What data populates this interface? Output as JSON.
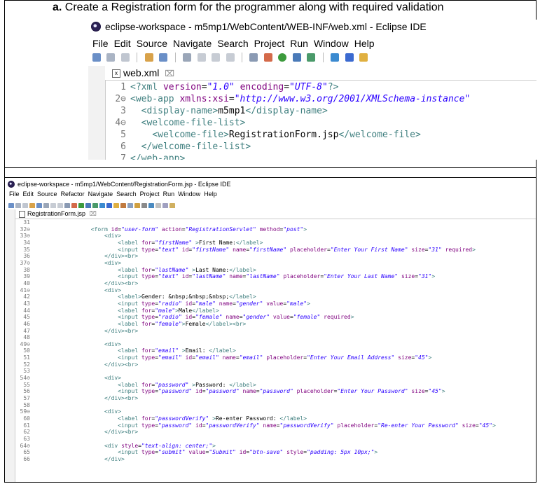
{
  "caption": {
    "prefix": "a.",
    "text": " Create a Registration form for the programmer along with required validation"
  },
  "top_window": {
    "title": "eclipse-workspace - m5mp1/WebContent/WEB-INF/web.xml - Eclipse IDE",
    "menu": [
      "File",
      "Edit",
      "Source",
      "Navigate",
      "Search",
      "Project",
      "Run",
      "Window",
      "Help"
    ],
    "tab_label": "web.xml",
    "tab_close": "⌧",
    "lines": [
      {
        "n": "1",
        "html": "<span class=\"tag\">&lt;?xml </span><span class=\"attr\">version</span><span class=\"plain\">=</span><span class=\"val\">\"1.0\"</span><span class=\"plain\"> </span><span class=\"attr\">encoding</span><span class=\"plain\">=</span><span class=\"val\">\"UTF-8\"</span><span class=\"tag\">?&gt;</span>"
      },
      {
        "n": "2⊖",
        "html": "<span class=\"tag\">&lt;web-app </span><span class=\"attr\">xmlns:xsi</span><span class=\"plain\">=</span><span class=\"val\">\"http://www.w3.org/2001/XMLSchema-instance\"</span>"
      },
      {
        "n": "3",
        "html": "  <span class=\"tag\">&lt;display-name&gt;</span><span class=\"plain\">m5mp1</span><span class=\"tag\">&lt;/display-name&gt;</span>"
      },
      {
        "n": "4⊖",
        "html": "  <span class=\"tag\">&lt;welcome-file-list&gt;</span>"
      },
      {
        "n": "5",
        "html": "    <span class=\"tag\">&lt;welcome-file&gt;</span><span class=\"plain\">RegistrationForm.jsp</span><span class=\"tag\">&lt;/welcome-file&gt;</span>"
      },
      {
        "n": "6",
        "html": "  <span class=\"tag\">&lt;/welcome-file-list&gt;</span>"
      },
      {
        "n": "7",
        "html": "<span class=\"tag\">&lt;/web-app&gt;</span>"
      }
    ]
  },
  "bottom_window": {
    "title": "eclipse-workspace - m5mp1/WebContent/RegistrationForm.jsp - Eclipse IDE",
    "menu": [
      "File",
      "Edit",
      "Source",
      "Refactor",
      "Navigate",
      "Search",
      "Project",
      "Run",
      "Window",
      "Help"
    ],
    "tab_label": "RegistrationForm.jsp",
    "tab_close": "⌧",
    "lines": [
      {
        "n": "31",
        "html": ""
      },
      {
        "n": "32⊖",
        "html": "                  <span class=\"tag\">&lt;form </span><span class=\"attr\">id</span>=<span class=\"val\">\"user-form\"</span> <span class=\"attr\">action</span>=<span class=\"val\">\"RegistrationServlet\"</span> <span class=\"attr\">method</span>=<span class=\"val\">\"post\"</span><span class=\"tag\">&gt;</span>"
      },
      {
        "n": "33⊖",
        "html": "                      <span class=\"tag\">&lt;div&gt;</span>"
      },
      {
        "n": "34",
        "html": "                          <span class=\"tag\">&lt;label </span><span class=\"attr\">for</span>=<span class=\"val\">\"firstName\"</span> <span class=\"tag\">&gt;</span>First Name:<span class=\"tag\">&lt;/label&gt;</span>"
      },
      {
        "n": "35",
        "html": "                          <span class=\"tag\">&lt;input </span><span class=\"attr\">type</span>=<span class=\"val\">\"text\"</span> <span class=\"attr\">id</span>=<span class=\"val\">\"firstName\"</span> <span class=\"attr\">name</span>=<span class=\"val\">\"firstName\"</span> <span class=\"attr\">placeholder</span>=<span class=\"val\">\"Enter Your First Name\"</span> <span class=\"attr\">size</span>=<span class=\"val\">\"31\"</span> <span class=\"attr\">required</span><span class=\"tag\">&gt;</span>"
      },
      {
        "n": "36",
        "html": "                      <span class=\"tag\">&lt;/div&gt;&lt;br&gt;</span>"
      },
      {
        "n": "37⊖",
        "html": "                      <span class=\"tag\">&lt;div&gt;</span>"
      },
      {
        "n": "38",
        "html": "                          <span class=\"tag\">&lt;label </span><span class=\"attr\">for</span>=<span class=\"val\">\"lastName\"</span> <span class=\"tag\">&gt;</span>Last Name:<span class=\"tag\">&lt;/label&gt;</span>"
      },
      {
        "n": "39",
        "html": "                          <span class=\"tag\">&lt;input </span><span class=\"attr\">type</span>=<span class=\"val\">\"text\"</span> <span class=\"attr\">id</span>=<span class=\"val\">\"lastName\"</span> <span class=\"attr\">name</span>=<span class=\"val\">\"lastName\"</span> <span class=\"attr\">placeholder</span>=<span class=\"val\">\"Enter Your Last Name\"</span> <span class=\"attr\">size</span>=<span class=\"val\">\"31\"</span><span class=\"tag\">&gt;</span>"
      },
      {
        "n": "40",
        "html": "                      <span class=\"tag\">&lt;/div&gt;&lt;br&gt;</span>"
      },
      {
        "n": "41⊖",
        "html": "                      <span class=\"tag\">&lt;div&gt;</span>"
      },
      {
        "n": "42",
        "html": "                          <span class=\"tag\">&lt;label&gt;</span>Gender: &amp;nbsp;&amp;nbsp;&amp;nbsp;<span class=\"tag\">&lt;/label&gt;</span>"
      },
      {
        "n": "43",
        "html": "                          <span class=\"tag\">&lt;input </span><span class=\"attr\">type</span>=<span class=\"val\">\"radio\"</span> <span class=\"attr\">id</span>=<span class=\"val\">\"male\"</span> <span class=\"attr\">name</span>=<span class=\"val\">\"gender\"</span> <span class=\"attr\">value</span>=<span class=\"val\">\"male\"</span><span class=\"tag\">&gt;</span>"
      },
      {
        "n": "44",
        "html": "                          <span class=\"tag\">&lt;label </span><span class=\"attr\">for</span>=<span class=\"val\">\"male\"</span><span class=\"tag\">&gt;</span>Male<span class=\"tag\">&lt;/label&gt;</span>"
      },
      {
        "n": "45",
        "html": "                          <span class=\"tag\">&lt;input </span><span class=\"attr\">type</span>=<span class=\"val\">\"radio\"</span> <span class=\"attr\">id</span>=<span class=\"val\">\"female\"</span> <span class=\"attr\">name</span>=<span class=\"val\">\"gender\"</span> <span class=\"attr\">value</span>=<span class=\"val\">\"female\"</span> <span class=\"attr\">required</span><span class=\"tag\">&gt;</span>"
      },
      {
        "n": "46",
        "html": "                          <span class=\"tag\">&lt;label </span><span class=\"attr\">for</span>=<span class=\"val\">\"female\"</span><span class=\"tag\">&gt;</span>Female<span class=\"tag\">&lt;/label&gt;&lt;br&gt;</span>"
      },
      {
        "n": "47",
        "html": "                      <span class=\"tag\">&lt;/div&gt;&lt;br&gt;</span>"
      },
      {
        "n": "48",
        "html": ""
      },
      {
        "n": "49⊖",
        "html": "                      <span class=\"tag\">&lt;div&gt;</span>"
      },
      {
        "n": "50",
        "html": "                          <span class=\"tag\">&lt;label </span><span class=\"attr\">for</span>=<span class=\"val\">\"email\"</span> <span class=\"tag\">&gt;</span>Email: <span class=\"tag\">&lt;/label&gt;</span>"
      },
      {
        "n": "51",
        "html": "                          <span class=\"tag\">&lt;input </span><span class=\"attr\">type</span>=<span class=\"val\">\"email\"</span> <span class=\"attr\">id</span>=<span class=\"val\">\"email\"</span> <span class=\"attr\">name</span>=<span class=\"val\">\"email\"</span> <span class=\"attr\">placeholder</span>=<span class=\"val\">\"Enter Your Email Address\"</span> <span class=\"attr\">size</span>=<span class=\"val\">\"45\"</span><span class=\"tag\">&gt;</span>"
      },
      {
        "n": "52",
        "html": "                      <span class=\"tag\">&lt;/div&gt;&lt;br&gt;</span>"
      },
      {
        "n": "53",
        "html": ""
      },
      {
        "n": "54⊖",
        "html": "                      <span class=\"tag\">&lt;div&gt;</span>"
      },
      {
        "n": "55",
        "html": "                          <span class=\"tag\">&lt;label </span><span class=\"attr\">for</span>=<span class=\"val\">\"password\"</span> <span class=\"tag\">&gt;</span>Password: <span class=\"tag\">&lt;/label&gt;</span>"
      },
      {
        "n": "56",
        "html": "                          <span class=\"tag\">&lt;input </span><span class=\"attr\">type</span>=<span class=\"val\">\"password\"</span> <span class=\"attr\">id</span>=<span class=\"val\">\"password\"</span> <span class=\"attr\">name</span>=<span class=\"val\">\"password\"</span> <span class=\"attr\">placeholder</span>=<span class=\"val\">\"Enter Your Password\"</span> <span class=\"attr\">size</span>=<span class=\"val\">\"45\"</span><span class=\"tag\">&gt;</span>"
      },
      {
        "n": "57",
        "html": "                      <span class=\"tag\">&lt;/div&gt;&lt;br&gt;</span>"
      },
      {
        "n": "58",
        "html": ""
      },
      {
        "n": "59⊖",
        "html": "                      <span class=\"tag\">&lt;div&gt;</span>"
      },
      {
        "n": "60",
        "html": "                          <span class=\"tag\">&lt;label </span><span class=\"attr\">for</span>=<span class=\"val\">\"passwordVerify\"</span> <span class=\"tag\">&gt;</span>Re-enter Password: <span class=\"tag\">&lt;/label&gt;</span>"
      },
      {
        "n": "61",
        "html": "                          <span class=\"tag\">&lt;input </span><span class=\"attr\">type</span>=<span class=\"val\">\"password\"</span> <span class=\"attr\">id</span>=<span class=\"val\">\"passwordVerify\"</span> <span class=\"attr\">name</span>=<span class=\"val\">\"passwordVerify\"</span> <span class=\"attr\">placeholder</span>=<span class=\"val\">\"Re-enter Your Password\"</span> <span class=\"attr\">size</span>=<span class=\"val\">\"45\"</span><span class=\"tag\">&gt;</span>"
      },
      {
        "n": "62",
        "html": "                      <span class=\"tag\">&lt;/div&gt;&lt;br&gt;</span>"
      },
      {
        "n": "63",
        "html": ""
      },
      {
        "n": "64⊖",
        "html": "                      <span class=\"tag\">&lt;div </span><span class=\"attr\">style</span>=<span class=\"val\">\"text-align: center;\"</span><span class=\"tag\">&gt;</span>"
      },
      {
        "n": "65",
        "html": "                          <span class=\"tag\">&lt;input </span><span class=\"attr\">type</span>=<span class=\"val\">\"submit\"</span> <span class=\"attr\">value</span>=<span class=\"val\">\"Submit\"</span> <span class=\"attr\">id</span>=<span class=\"val\">\"btn-save\"</span> <span class=\"attr\">style</span>=<span class=\"val\">\"padding: 5px 10px;\"</span><span class=\"tag\">&gt;</span>"
      },
      {
        "n": "66",
        "html": "                      <span class=\"tag\">&lt;/div&gt;</span>"
      }
    ]
  },
  "colors": {
    "tag": "#3f7f7f",
    "attr": "#7f007f",
    "value": "#2a00ff",
    "line_number": "#787878"
  }
}
